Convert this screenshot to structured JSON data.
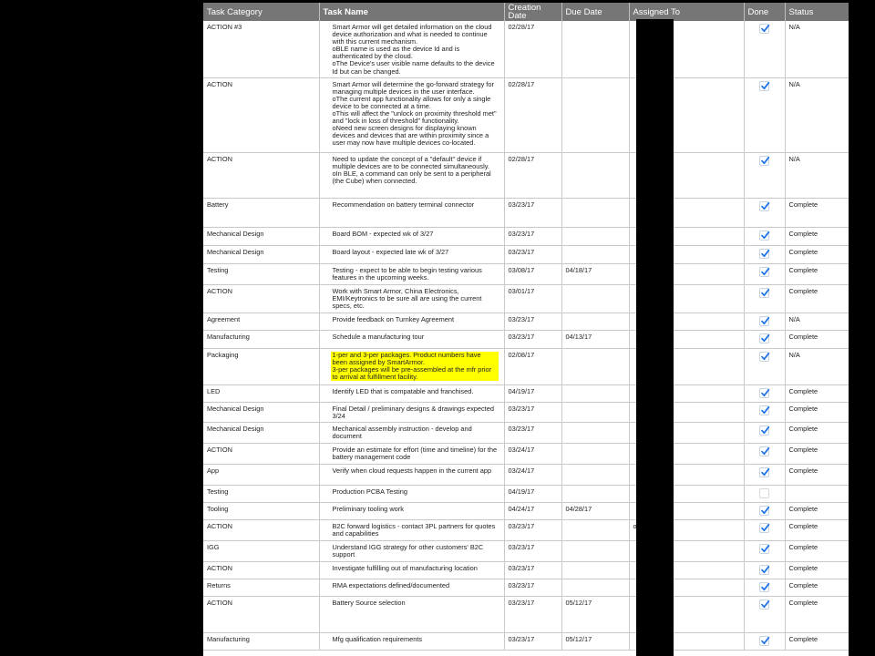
{
  "columns": {
    "category": "Task Category",
    "task": "Task Name",
    "creation_date": "Creation\nDate",
    "due_date": "Due Date",
    "assigned_to": "Assigned To",
    "done": "Done",
    "status": "Status"
  },
  "rows": [
    {
      "category": "ACTION #3",
      "task": "Smart Armor will get detailed information on the cloud device authorization and what is needed to continue with this current mechanism.\noBLE name is used as the device Id and is authenticated by the cloud.\noThe Device's user visible name defaults to the device Id but can be changed.",
      "created": "02/28/17",
      "due": "",
      "assigned": "",
      "done": true,
      "status": "N/A",
      "highlight": false
    },
    {
      "category": "ACTION",
      "task": "Smart Armor will determine the go-forward strategy for managing multiple devices in the user interface.\noThe current app functionality allows for only a single device to be connected at a time.\noThis will affect the \"unlock on proximity threshold met\" and \"lock in loss of threshold\" functionality.\noNeed new screen designs for displaying known devices and devices that are within proximity since a user may now have multiple devices co-located.",
      "created": "02/28/17",
      "due": "",
      "assigned": "",
      "done": true,
      "status": "N/A",
      "highlight": false
    },
    {
      "category": "ACTION",
      "task": "Need to update the concept of a \"default\" device if multiple devices are to be connected simultaneously.\noIn BLE, a command can only be sent to a peripheral (the Cube) when connected.",
      "created": "02/28/17",
      "due": "",
      "assigned": "",
      "done": true,
      "status": "N/A",
      "highlight": false
    },
    {
      "category": "Battery",
      "task": "Recommendation on battery terminal connector",
      "created": "03/23/17",
      "due": "",
      "assigned": "",
      "done": true,
      "status": "Complete",
      "highlight": false
    },
    {
      "category": "Mechanical Design",
      "task": "Board BOM - expected wk of 3/27",
      "created": "03/23/17",
      "due": "",
      "assigned": "",
      "done": true,
      "status": "Complete",
      "highlight": false
    },
    {
      "category": "Mechanical Design",
      "task": "Board layout - expected late wk of 3/27",
      "created": "03/23/17",
      "due": "",
      "assigned": "",
      "done": true,
      "status": "Complete",
      "highlight": false
    },
    {
      "category": "Testing",
      "task": "Testing - expect to be able to begin testing various features in the upcoming weeks.",
      "created": "03/08/17",
      "due": "04/18/17",
      "assigned": "",
      "done": true,
      "status": "Complete",
      "highlight": false
    },
    {
      "category": "ACTION",
      "task": "Work with Smart Armor, China Electronics, EMI/Keytronics to be sure all are using the current specs, etc.",
      "created": "03/01/17",
      "due": "",
      "assigned": "",
      "done": true,
      "status": "Complete",
      "highlight": false
    },
    {
      "category": "Agreement",
      "task": "Provide feedback on Turnkey Agreement",
      "created": "03/23/17",
      "due": "",
      "assigned": "",
      "done": true,
      "status": "N/A",
      "highlight": false
    },
    {
      "category": "Manufacturing",
      "task": "Schedule a manufacturing tour",
      "created": "03/23/17",
      "due": "04/13/17",
      "assigned": "",
      "done": true,
      "status": "Complete",
      "highlight": false
    },
    {
      "category": "Packaging",
      "task": "1-per and 3-per packages.  Product numbers have been assigned by SmartArmor.\n3-per packages will be pre-assembled at the mfr prior to arrival at fulfillment facility.",
      "created": "02/08/17",
      "due": "",
      "assigned": "",
      "done": true,
      "status": "N/A",
      "highlight": true
    },
    {
      "category": "LED",
      "task": "Identify LED that is compatable and franchised.",
      "created": "04/19/17",
      "due": "",
      "assigned": "",
      "done": true,
      "status": "Complete",
      "highlight": false
    },
    {
      "category": "Mechanical Design",
      "task": "Final Detail / preliminary designs & drawings expected 3/24",
      "created": "03/23/17",
      "due": "",
      "assigned": "",
      "done": true,
      "status": "Complete",
      "highlight": false
    },
    {
      "category": "Mechanical Design",
      "task": "Mechanical assembly instruction - develop and document",
      "created": "03/23/17",
      "due": "",
      "assigned": "",
      "done": true,
      "status": "Complete",
      "highlight": false
    },
    {
      "category": "ACTION",
      "task": "Provide an estimate for effort (time and timeline) for the battery management code",
      "created": "03/24/17",
      "due": "",
      "assigned": "",
      "done": true,
      "status": "Complete",
      "highlight": false
    },
    {
      "category": "App",
      "task": "Verify when cloud requests happen in the current app",
      "created": "03/24/17",
      "due": "",
      "assigned": "",
      "done": true,
      "status": "Complete",
      "highlight": false
    },
    {
      "category": "Testing",
      "task": "Production PCBA Testing",
      "created": "04/19/17",
      "due": "",
      "assigned": "",
      "done": false,
      "status": "",
      "highlight": false
    },
    {
      "category": "Tooling",
      "task": "Preliminary tooling work",
      "created": "04/24/17",
      "due": "04/28/17",
      "assigned": "",
      "done": true,
      "status": "Complete",
      "highlight": false
    },
    {
      "category": "ACTION",
      "task": "B2C forward logistics - contact 3PL partners for quotes and capabilities",
      "created": "03/23/17",
      "due": "",
      "assigned": "or",
      "done": true,
      "status": "Complete",
      "highlight": false
    },
    {
      "category": "IGG",
      "task": "Understand IGG strategy for other customers' B2C support",
      "created": "03/23/17",
      "due": "",
      "assigned": "",
      "done": true,
      "status": "Complete",
      "highlight": false
    },
    {
      "category": "ACTION",
      "task": "Investigate fulfilling out of manufacturing location",
      "created": "03/23/17",
      "due": "",
      "assigned": "",
      "done": true,
      "status": "Complete",
      "highlight": false
    },
    {
      "category": "Returns",
      "task": "RMA expectations defined/documented",
      "created": "03/23/17",
      "due": "",
      "assigned": "",
      "done": true,
      "status": "Complete",
      "highlight": false
    },
    {
      "category": "ACTION",
      "task": "Battery Source selection",
      "created": "03/23/17",
      "due": "05/12/17",
      "assigned": "",
      "done": true,
      "status": "Complete",
      "highlight": false
    },
    {
      "category": "Manufacturing",
      "task": "Mfg qualification requirements",
      "created": "03/23/17",
      "due": "05/12/17",
      "assigned": "",
      "done": true,
      "status": "Complete",
      "highlight": false
    }
  ],
  "icons": {
    "done_checked": "checkbox-checked-icon",
    "done_unchecked": "checkbox-empty-icon"
  },
  "colors": {
    "header_bg": "#767676",
    "highlight": "#ffff00",
    "check": "#1a73e8"
  }
}
